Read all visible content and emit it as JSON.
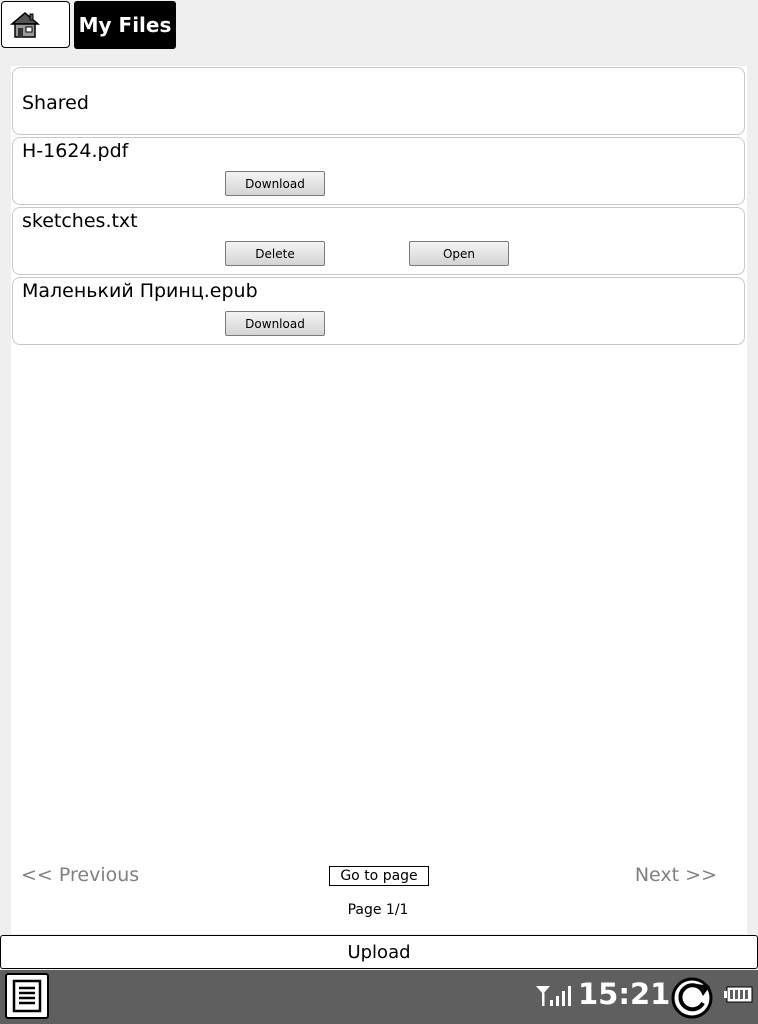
{
  "header": {
    "title": "My Files"
  },
  "files": [
    {
      "name": "Shared"
    },
    {
      "name": "H-1624.pdf",
      "buttons": [
        "Download"
      ]
    },
    {
      "name": "sketches.txt",
      "buttons": [
        "Delete",
        "Open"
      ]
    },
    {
      "name": "Маленький Принц.epub",
      "buttons": [
        "Download"
      ]
    }
  ],
  "pager": {
    "previous": "<< Previous",
    "goto": "Go to page",
    "next": "Next >>",
    "page_label": "Page 1/1"
  },
  "upload_label": "Upload",
  "status": {
    "time": "15:21"
  },
  "icons": {
    "home": "house-icon",
    "menu": "menu-list-icon",
    "signal": "signal-icon",
    "refresh": "refresh-icon",
    "battery": "battery-icon"
  }
}
